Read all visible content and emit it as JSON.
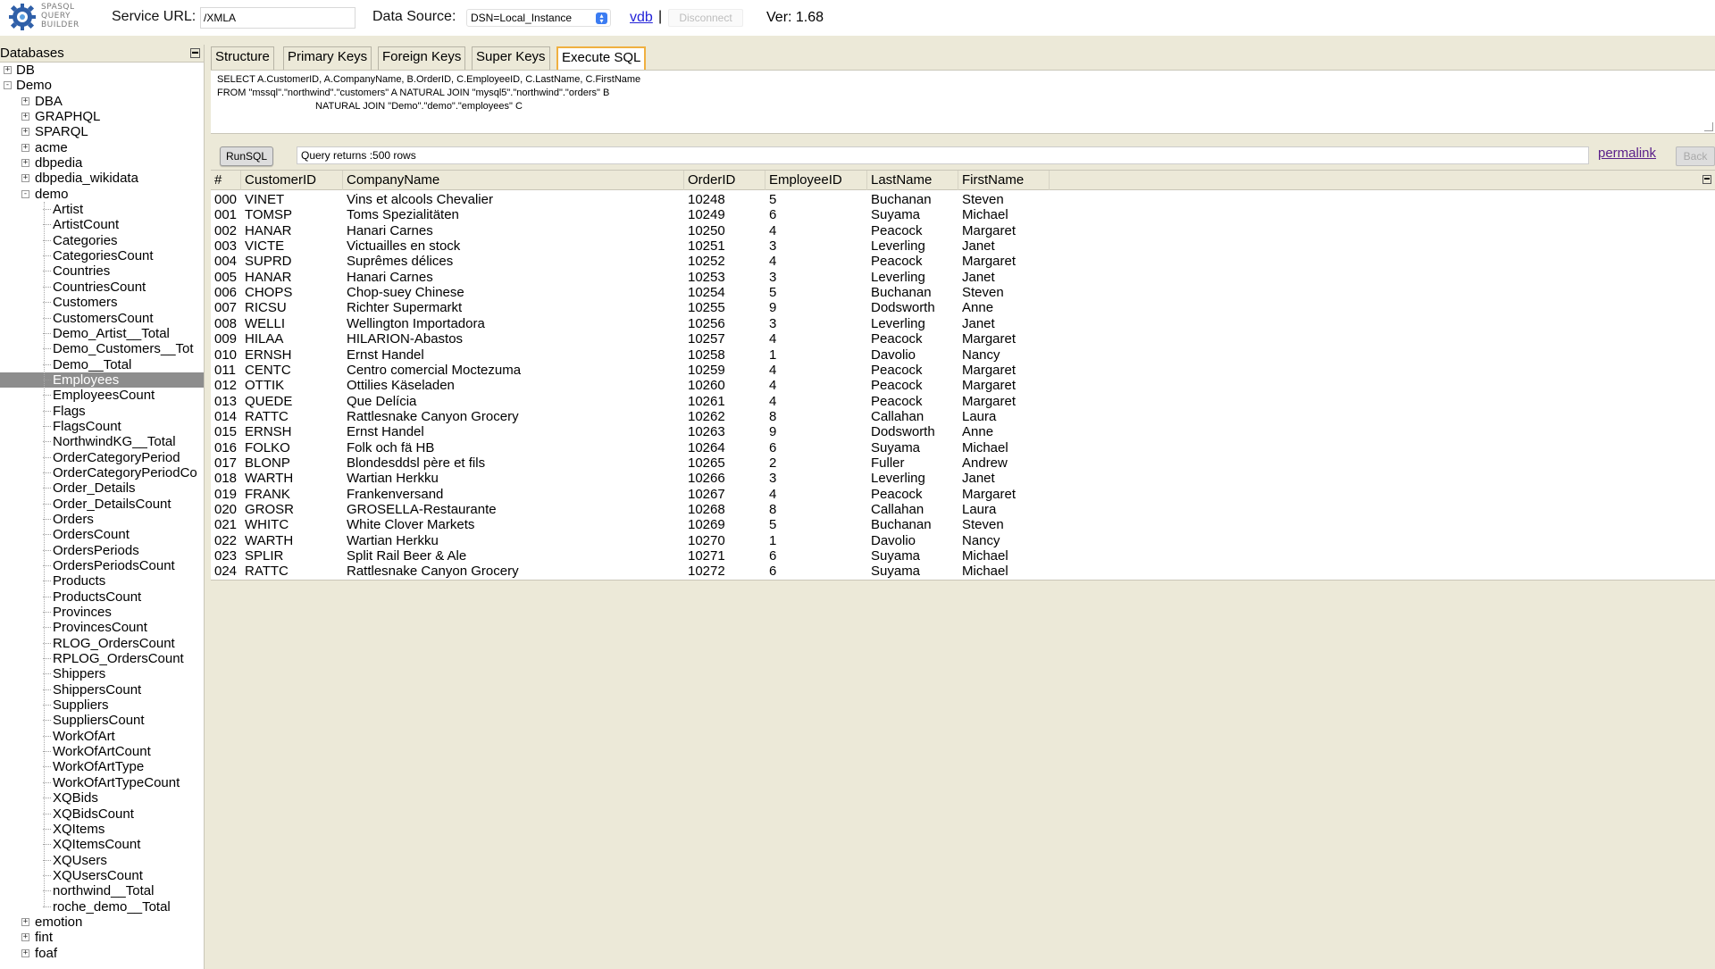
{
  "header": {
    "logo_lines": [
      "SPASQL",
      "QUERY",
      "BUILDER"
    ],
    "service_url_label": "Service URL:",
    "service_url_value": "/XMLA",
    "data_source_label": "Data Source:",
    "data_source_value": "DSN=Local_Instance",
    "vdb_link": "vdb",
    "separator": "|",
    "disconnect_label": "Disconnect",
    "version": "Ver: 1.68"
  },
  "sidebar": {
    "title": "Databases",
    "tree": [
      {
        "label": "DB",
        "level": 0,
        "expander": "+"
      },
      {
        "label": "Demo",
        "level": 0,
        "expander": "-"
      },
      {
        "label": "DBA",
        "level": 1,
        "expander": "+"
      },
      {
        "label": "GRAPHQL",
        "level": 1,
        "expander": "+"
      },
      {
        "label": "SPARQL",
        "level": 1,
        "expander": "+"
      },
      {
        "label": "acme",
        "level": 1,
        "expander": "+"
      },
      {
        "label": "dbpedia",
        "level": 1,
        "expander": "+"
      },
      {
        "label": "dbpedia_wikidata",
        "level": 1,
        "expander": "+"
      },
      {
        "label": "demo",
        "level": 1,
        "expander": "-"
      },
      {
        "label": "Artist",
        "level": 2
      },
      {
        "label": "ArtistCount",
        "level": 2
      },
      {
        "label": "Categories",
        "level": 2
      },
      {
        "label": "CategoriesCount",
        "level": 2
      },
      {
        "label": "Countries",
        "level": 2
      },
      {
        "label": "CountriesCount",
        "level": 2
      },
      {
        "label": "Customers",
        "level": 2
      },
      {
        "label": "CustomersCount",
        "level": 2
      },
      {
        "label": "Demo_Artist__Total",
        "level": 2
      },
      {
        "label": "Demo_Customers__Tot",
        "level": 2
      },
      {
        "label": "Demo__Total",
        "level": 2
      },
      {
        "label": "Employees",
        "level": 2,
        "selected": true
      },
      {
        "label": "EmployeesCount",
        "level": 2
      },
      {
        "label": "Flags",
        "level": 2
      },
      {
        "label": "FlagsCount",
        "level": 2
      },
      {
        "label": "NorthwindKG__Total",
        "level": 2
      },
      {
        "label": "OrderCategoryPeriod",
        "level": 2
      },
      {
        "label": "OrderCategoryPeriodCo",
        "level": 2
      },
      {
        "label": "Order_Details",
        "level": 2
      },
      {
        "label": "Order_DetailsCount",
        "level": 2
      },
      {
        "label": "Orders",
        "level": 2
      },
      {
        "label": "OrdersCount",
        "level": 2
      },
      {
        "label": "OrdersPeriods",
        "level": 2
      },
      {
        "label": "OrdersPeriodsCount",
        "level": 2
      },
      {
        "label": "Products",
        "level": 2
      },
      {
        "label": "ProductsCount",
        "level": 2
      },
      {
        "label": "Provinces",
        "level": 2
      },
      {
        "label": "ProvincesCount",
        "level": 2
      },
      {
        "label": "RLOG_OrdersCount",
        "level": 2
      },
      {
        "label": "RPLOG_OrdersCount",
        "level": 2
      },
      {
        "label": "Shippers",
        "level": 2
      },
      {
        "label": "ShippersCount",
        "level": 2
      },
      {
        "label": "Suppliers",
        "level": 2
      },
      {
        "label": "SuppliersCount",
        "level": 2
      },
      {
        "label": "WorkOfArt",
        "level": 2
      },
      {
        "label": "WorkOfArtCount",
        "level": 2
      },
      {
        "label": "WorkOfArtType",
        "level": 2
      },
      {
        "label": "WorkOfArtTypeCount",
        "level": 2
      },
      {
        "label": "XQBids",
        "level": 2
      },
      {
        "label": "XQBidsCount",
        "level": 2
      },
      {
        "label": "XQItems",
        "level": 2
      },
      {
        "label": "XQItemsCount",
        "level": 2
      },
      {
        "label": "XQUsers",
        "level": 2
      },
      {
        "label": "XQUsersCount",
        "level": 2
      },
      {
        "label": "northwind__Total",
        "level": 2
      },
      {
        "label": "roche_demo__Total",
        "level": 2
      },
      {
        "label": "emotion",
        "level": 1,
        "expander": "+"
      },
      {
        "label": "fint",
        "level": 1,
        "expander": "+"
      },
      {
        "label": "foaf",
        "level": 1,
        "expander": "+"
      }
    ]
  },
  "tabs": [
    {
      "label": "Structure",
      "active": false
    },
    {
      "label": "Primary Keys",
      "active": false
    },
    {
      "label": "Foreign Keys",
      "active": false
    },
    {
      "label": "Super Keys",
      "active": false
    },
    {
      "label": "Execute SQL",
      "active": true
    }
  ],
  "sql": {
    "text": "SELECT A.CustomerID, A.CompanyName, B.OrderID, C.EmployeeID, C.LastName, C.FirstName\nFROM \"mssql\".\"northwind\".\"customers\" A NATURAL JOIN \"mysql5\".\"northwind\".\"orders\" B\n                                    NATURAL JOIN \"Demo\".\"demo\".\"employees\" C"
  },
  "controls": {
    "run_label": "RunSQL",
    "status": "Query returns :500 rows",
    "permalink": "permalink",
    "back_label": "Back"
  },
  "grid": {
    "columns": [
      "#",
      "CustomerID",
      "CompanyName",
      "OrderID",
      "EmployeeID",
      "LastName",
      "FirstName"
    ],
    "rows": [
      [
        "000",
        "VINET",
        "Vins et alcools Chevalier",
        "10248",
        "5",
        "Buchanan",
        "Steven"
      ],
      [
        "001",
        "TOMSP",
        "Toms Spezialitäten",
        "10249",
        "6",
        "Suyama",
        "Michael"
      ],
      [
        "002",
        "HANAR",
        "Hanari Carnes",
        "10250",
        "4",
        "Peacock",
        "Margaret"
      ],
      [
        "003",
        "VICTE",
        "Victuailles en stock",
        "10251",
        "3",
        "Leverling",
        "Janet"
      ],
      [
        "004",
        "SUPRD",
        "Suprêmes délices",
        "10252",
        "4",
        "Peacock",
        "Margaret"
      ],
      [
        "005",
        "HANAR",
        "Hanari Carnes",
        "10253",
        "3",
        "Leverling",
        "Janet"
      ],
      [
        "006",
        "CHOPS",
        "Chop-suey Chinese",
        "10254",
        "5",
        "Buchanan",
        "Steven"
      ],
      [
        "007",
        "RICSU",
        "Richter Supermarkt",
        "10255",
        "9",
        "Dodsworth",
        "Anne"
      ],
      [
        "008",
        "WELLI",
        "Wellington Importadora",
        "10256",
        "3",
        "Leverling",
        "Janet"
      ],
      [
        "009",
        "HILAA",
        "HILARION-Abastos",
        "10257",
        "4",
        "Peacock",
        "Margaret"
      ],
      [
        "010",
        "ERNSH",
        "Ernst Handel",
        "10258",
        "1",
        "Davolio",
        "Nancy"
      ],
      [
        "011",
        "CENTC",
        "Centro comercial Moctezuma",
        "10259",
        "4",
        "Peacock",
        "Margaret"
      ],
      [
        "012",
        "OTTIK",
        "Ottilies Käseladen",
        "10260",
        "4",
        "Peacock",
        "Margaret"
      ],
      [
        "013",
        "QUEDE",
        "Que Delícia",
        "10261",
        "4",
        "Peacock",
        "Margaret"
      ],
      [
        "014",
        "RATTC",
        "Rattlesnake Canyon Grocery",
        "10262",
        "8",
        "Callahan",
        "Laura"
      ],
      [
        "015",
        "ERNSH",
        "Ernst Handel",
        "10263",
        "9",
        "Dodsworth",
        "Anne"
      ],
      [
        "016",
        "FOLKO",
        "Folk och fä HB",
        "10264",
        "6",
        "Suyama",
        "Michael"
      ],
      [
        "017",
        "BLONP",
        "Blondesddsl père et fils",
        "10265",
        "2",
        "Fuller",
        "Andrew"
      ],
      [
        "018",
        "WARTH",
        "Wartian Herkku",
        "10266",
        "3",
        "Leverling",
        "Janet"
      ],
      [
        "019",
        "FRANK",
        "Frankenversand",
        "10267",
        "4",
        "Peacock",
        "Margaret"
      ],
      [
        "020",
        "GROSR",
        "GROSELLA-Restaurante",
        "10268",
        "8",
        "Callahan",
        "Laura"
      ],
      [
        "021",
        "WHITC",
        "White Clover Markets",
        "10269",
        "5",
        "Buchanan",
        "Steven"
      ],
      [
        "022",
        "WARTH",
        "Wartian Herkku",
        "10270",
        "1",
        "Davolio",
        "Nancy"
      ],
      [
        "023",
        "SPLIR",
        "Split Rail Beer & Ale",
        "10271",
        "6",
        "Suyama",
        "Michael"
      ],
      [
        "024",
        "RATTC",
        "Rattlesnake Canyon Grocery",
        "10272",
        "6",
        "Suyama",
        "Michael"
      ]
    ]
  }
}
